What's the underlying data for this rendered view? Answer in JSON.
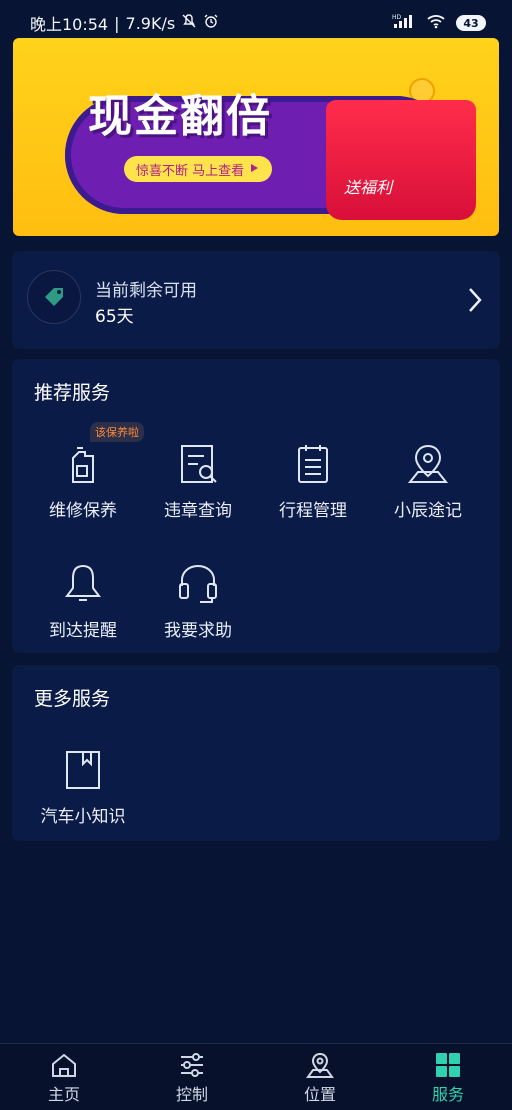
{
  "status_bar": {
    "time": "晚上10:54",
    "speed": "7.9K/s",
    "battery": "43",
    "signal_label": "HD"
  },
  "banner": {
    "title": "现金翻倍",
    "cta": "惊喜不断 马上查看",
    "gift_text": "送福利",
    "colors": {
      "bg": "#ffd21b",
      "pill": "#6f1eb2",
      "gift": "#ff2d4a"
    }
  },
  "remaining": {
    "label": "当前剩余可用",
    "value": "65天"
  },
  "recommended": {
    "title": "推荐服务",
    "badge": "该保养啦",
    "items": [
      {
        "label": "维修保养",
        "icon": "oil-bottle-icon"
      },
      {
        "label": "违章查询",
        "icon": "document-search-icon"
      },
      {
        "label": "行程管理",
        "icon": "clipboard-icon"
      },
      {
        "label": "小辰途记",
        "icon": "map-pin-icon"
      },
      {
        "label": "到达提醒",
        "icon": "bell-icon"
      },
      {
        "label": "我要求助",
        "icon": "headset-icon"
      }
    ]
  },
  "more": {
    "title": "更多服务",
    "items": [
      {
        "label": "汽车小知识",
        "icon": "bookmark-book-icon"
      }
    ]
  },
  "bottom_nav": {
    "items": [
      {
        "label": "主页",
        "icon": "home-icon",
        "active": false
      },
      {
        "label": "控制",
        "icon": "sliders-icon",
        "active": false
      },
      {
        "label": "位置",
        "icon": "location-icon",
        "active": false
      },
      {
        "label": "服务",
        "icon": "grid-icon",
        "active": true
      }
    ],
    "active_color": "#2fd1b0"
  }
}
